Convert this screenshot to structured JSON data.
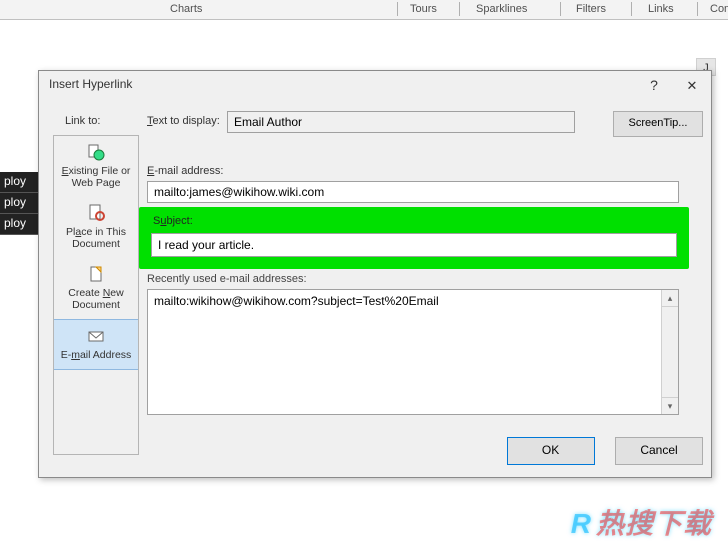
{
  "ribbon": {
    "charts": "Charts",
    "tours": "Tours",
    "sparklines": "Sparklines",
    "filters": "Filters",
    "links": "Links",
    "com": "Com"
  },
  "sheet": {
    "col_j": "J",
    "cells": [
      "ploy",
      "ploy",
      "ploy"
    ]
  },
  "dialog": {
    "title": "Insert Hyperlink",
    "help": "?",
    "close": "✕",
    "link_to_label": "Link to:",
    "sidebar": {
      "existing_prefix": "E",
      "existing": "xisting File or Web Page",
      "place_pre": "Pl",
      "place_key": "a",
      "place_post": "ce in This Document",
      "create_pre": "Create ",
      "create_key": "N",
      "create_post": "ew Document",
      "email_pre": "E-",
      "email_key": "m",
      "email_post": "ail Address"
    },
    "form": {
      "text_to_display_label_pre": "T",
      "text_to_display_label_post": "ext to display:",
      "text_to_display_value": "Email Author",
      "screentip_label": "ScreenTip...",
      "email_label_pre": "E",
      "email_label_post": "-mail address:",
      "email_value": "mailto:james@wikihow.wiki.com",
      "subject_label_pre": "S",
      "subject_label_key": "u",
      "subject_label_post": "bject:",
      "subject_value": "I read your article.",
      "recent_label": "Recently used e-mail addresses:",
      "recent_item": "mailto:wikihow@wikihow.com?subject=Test%20Email"
    },
    "buttons": {
      "ok": "OK",
      "cancel": "Cancel"
    }
  },
  "watermark": {
    "r": "R",
    "text": "热搜下载"
  }
}
